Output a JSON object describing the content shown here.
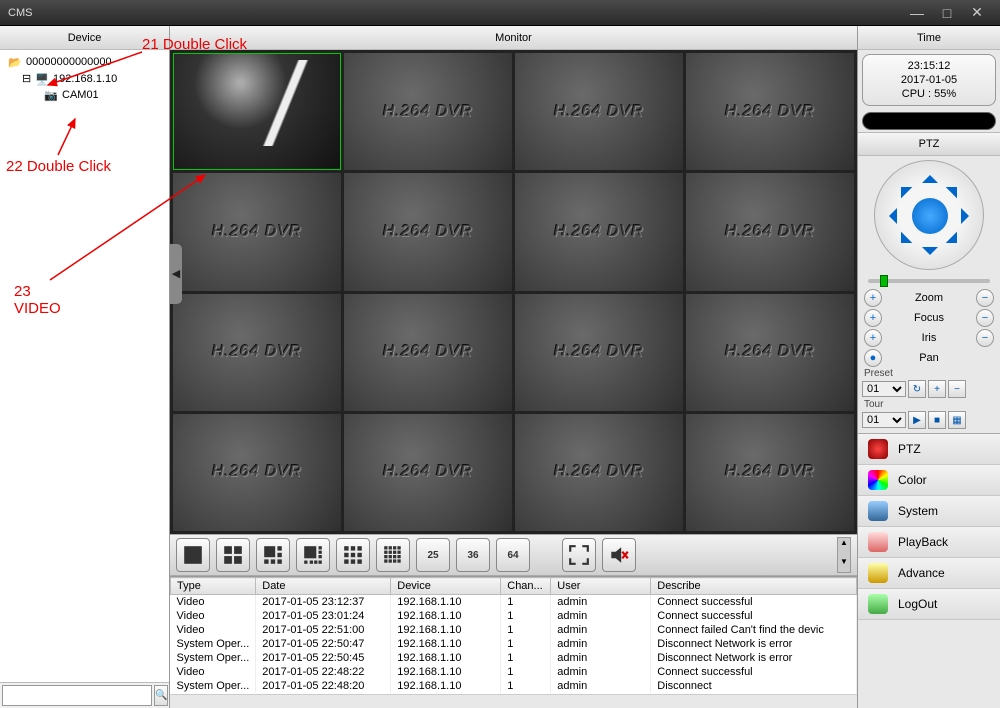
{
  "app_title": "CMS",
  "headers": {
    "device": "Device",
    "monitor": "Monitor",
    "time": "Time"
  },
  "tree": {
    "root": "00000000000000",
    "dvr": "192.168.1.10",
    "cam": "CAM01"
  },
  "info": {
    "time": "23:15:12",
    "date": "2017-01-05",
    "cpu": "CPU : 55%"
  },
  "ptz": {
    "title": "PTZ",
    "zoom": "Zoom",
    "focus": "Focus",
    "iris": "Iris",
    "pan": "Pan",
    "preset_label": "Preset",
    "preset_value": "01",
    "tour_label": "Tour",
    "tour_value": "01"
  },
  "grid_watermark": "H.264 DVR",
  "toolbar_nums": [
    "25",
    "36",
    "64"
  ],
  "menu": {
    "ptz": "PTZ",
    "color": "Color",
    "system": "System",
    "playback": "PlayBack",
    "advance": "Advance",
    "logout": "LogOut"
  },
  "log": {
    "cols": {
      "type": "Type",
      "date": "Date",
      "device": "Device",
      "chan": "Chan...",
      "user": "User",
      "desc": "Describe"
    },
    "rows": [
      {
        "type": "Video",
        "date": "2017-01-05 23:12:37",
        "device": "192.168.1.10",
        "chan": "1",
        "user": "admin",
        "desc": "Connect successful"
      },
      {
        "type": "Video",
        "date": "2017-01-05 23:01:24",
        "device": "192.168.1.10",
        "chan": "1",
        "user": "admin",
        "desc": "Connect successful"
      },
      {
        "type": "Video",
        "date": "2017-01-05 22:51:00",
        "device": "192.168.1.10",
        "chan": "1",
        "user": "admin",
        "desc": "Connect failed Can't find the devic"
      },
      {
        "type": "System Oper...",
        "date": "2017-01-05 22:50:47",
        "device": "192.168.1.10",
        "chan": "1",
        "user": "admin",
        "desc": "Disconnect Network is error"
      },
      {
        "type": "System Oper...",
        "date": "2017-01-05 22:50:45",
        "device": "192.168.1.10",
        "chan": "1",
        "user": "admin",
        "desc": "Disconnect Network is error"
      },
      {
        "type": "Video",
        "date": "2017-01-05 22:48:22",
        "device": "192.168.1.10",
        "chan": "1",
        "user": "admin",
        "desc": "Connect successful"
      },
      {
        "type": "System Oper...",
        "date": "2017-01-05 22:48:20",
        "device": "192.168.1.10",
        "chan": "1",
        "user": "admin",
        "desc": "Disconnect"
      }
    ]
  },
  "annot": {
    "a21": "21 Double Click",
    "a22": "22 Double Click",
    "a23_line1": "23",
    "a23_line2": "VIDEO"
  }
}
